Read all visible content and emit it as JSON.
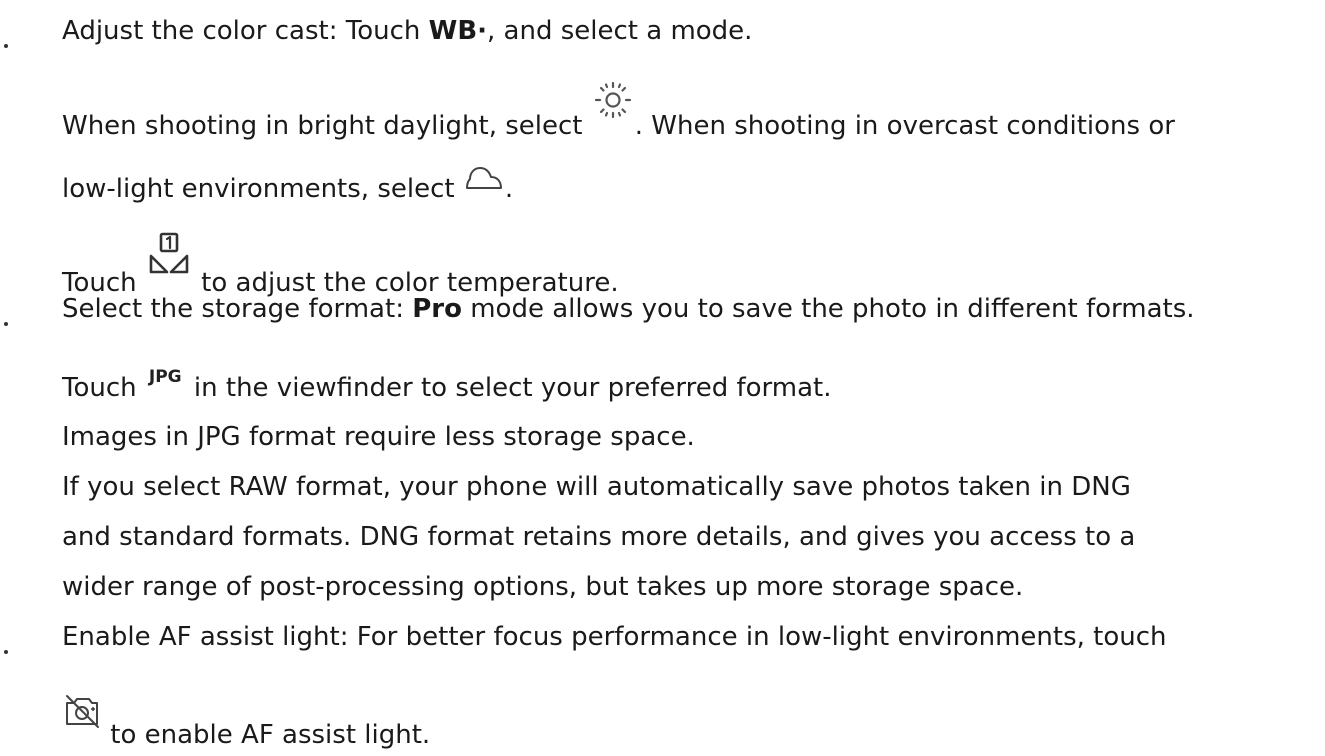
{
  "wb": {
    "prefix": "Adjust the color cast: Touch ",
    "wb_label": "WB·",
    "suffix": ", and select a mode.",
    "daylight_prefix": "When shooting in bright daylight, select ",
    "daylight_suffix": ". When shooting in overcast conditions or",
    "lowlight_prefix": "low-light environments, select ",
    "lowlight_suffix": ".",
    "temp_prefix": "Touch ",
    "temp_suffix": " to adjust the color temperature.",
    "icons": [
      "sun-icon",
      "cloud-icon",
      "color-temperature-icon"
    ]
  },
  "storage": {
    "prefix": "Select the storage format: ",
    "pro_label": "Pro",
    "suffix": " mode allows you to save the photo in different formats.",
    "touch_prefix": "Touch ",
    "jpg_label": "JPG",
    "touch_suffix": " in the viewfinder to select your preferred format.",
    "jpg_note": "Images in JPG format require less storage space.",
    "raw_line1": "If you select RAW format, your phone will automatically save photos taken in DNG",
    "raw_line2": "and standard formats. DNG format retains more details, and gives you access to a",
    "raw_line3": "wider range of post-processing options, but takes up more storage space."
  },
  "af": {
    "prefix": "Enable AF assist light: For better focus performance in low-light environments, touch",
    "suffix": " to enable AF assist light.",
    "icon": "af-assist-light-icon"
  }
}
